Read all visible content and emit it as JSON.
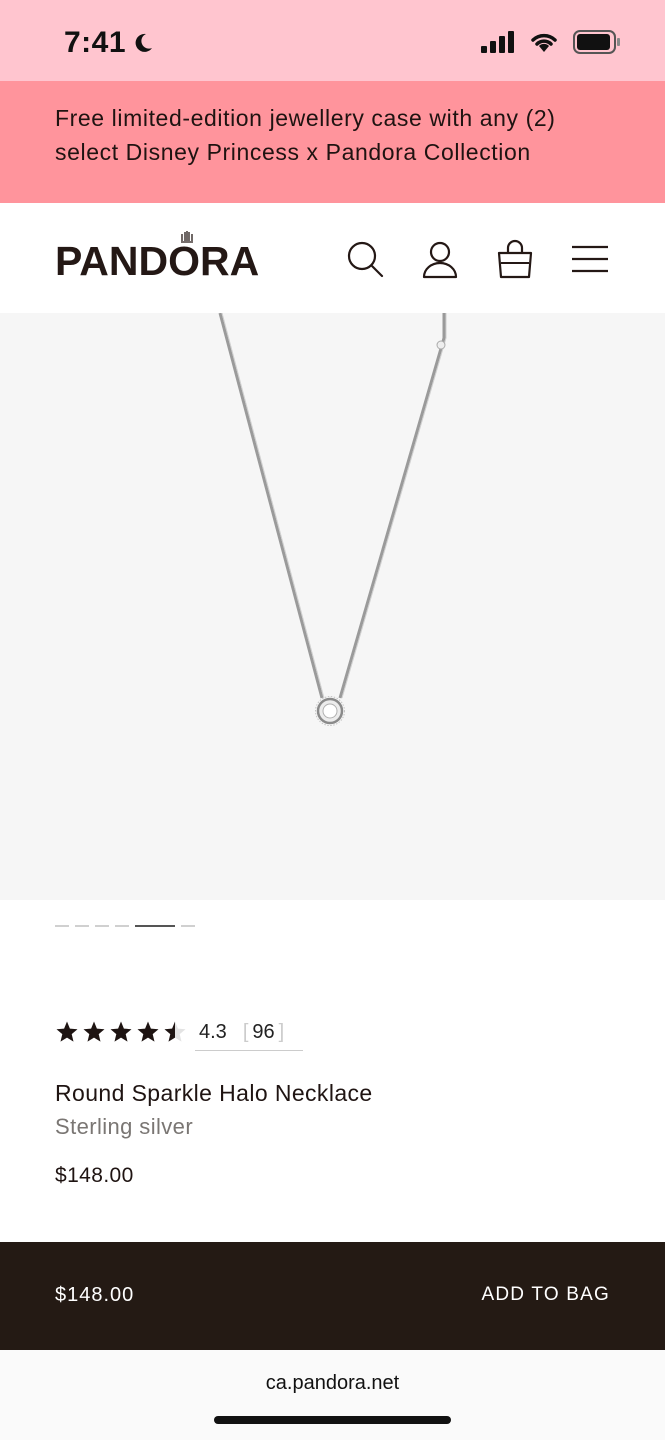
{
  "status_bar": {
    "time": "7:41"
  },
  "promo": {
    "text_line1": "Free limited-edition jewellery case with any (2)",
    "text_line2": "select Disney Princess x Pandora Collection"
  },
  "header": {
    "logo": "PANDORA",
    "icons": [
      "search-icon",
      "account-icon",
      "bag-icon",
      "menu-icon"
    ]
  },
  "gallery": {
    "image_count": 6,
    "active_index": 4
  },
  "product": {
    "rating": "4.3",
    "rating_value": 4.3,
    "review_count": "96",
    "name": "Round Sparkle Halo Necklace",
    "material": "Sterling silver",
    "price": "$148.00"
  },
  "sticky_bar": {
    "price": "$148.00",
    "add_to_bag_label": "ADD TO BAG"
  },
  "browser": {
    "url": "ca.pandora.net"
  },
  "colors": {
    "status_bg": "#ffc5cf",
    "promo_bg": "#ff949c",
    "dark": "#241a14"
  }
}
